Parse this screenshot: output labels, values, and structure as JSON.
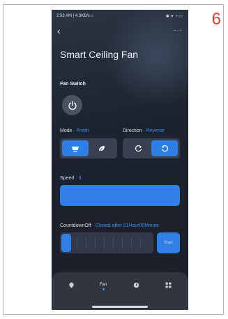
{
  "step_number": "6",
  "status_bar": {
    "left": "2:53 AM | 4.3KB/s ⌂",
    "right": "✱ ✈ ◔ ▭"
  },
  "header": {
    "back_glyph": "‹",
    "more_glyph": "···",
    "title": "Smart Ceiling Fan"
  },
  "fan_switch": {
    "label": "Fan Switch",
    "icon": "power-icon"
  },
  "mode": {
    "label": "Mode",
    "value": "· Fresh",
    "options": [
      "fresh-icon",
      "leaf-icon"
    ],
    "selected": 0
  },
  "direction": {
    "label": "Direction",
    "value": "· Reverse",
    "options": [
      "rotate-ccw-icon",
      "rotate-cw-icon"
    ],
    "selected": 1
  },
  "speed": {
    "label": "Speed",
    "value": "· 6"
  },
  "countdown": {
    "label": "CountdownOff",
    "value": "· Closed after 01Hour00Minute",
    "start_label": "Start"
  },
  "tabs": [
    {
      "icon": "bulb-icon",
      "label": ""
    },
    {
      "icon": "fan-icon",
      "label": "Fan",
      "active": true
    },
    {
      "icon": "clock-icon",
      "label": ""
    },
    {
      "icon": "grid-icon",
      "label": ""
    }
  ],
  "colors": {
    "accent": "#2f7fe5",
    "background": "#1d232e",
    "step_number": "#e23b2e"
  }
}
